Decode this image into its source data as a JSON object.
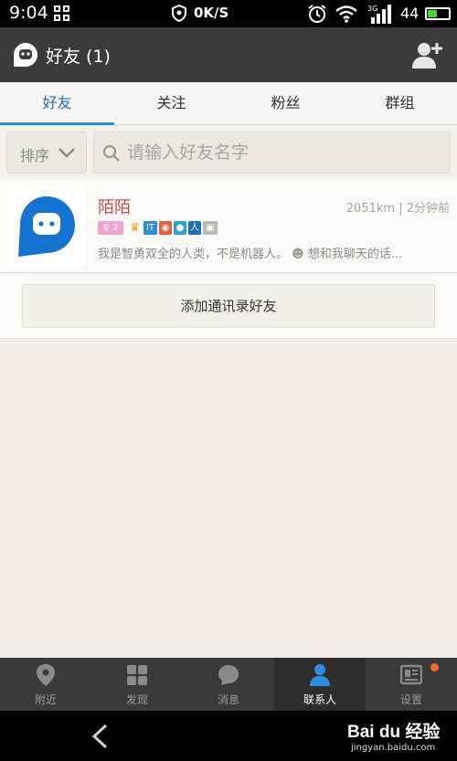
{
  "status_bar": {
    "time": "9:04",
    "network_speed": "0K/S",
    "battery_level": "44",
    "battery_fraction": 0.44
  },
  "header": {
    "title": "好友 (1)",
    "icons": {
      "logo": "momo-logo-icon",
      "action": "add-friend-icon"
    }
  },
  "tabs": [
    {
      "label": "好友",
      "active": true
    },
    {
      "label": "关注",
      "active": false
    },
    {
      "label": "粉丝",
      "active": false
    },
    {
      "label": "群组",
      "active": false
    }
  ],
  "toolbar": {
    "sort_label": "排序",
    "search_placeholder": "请输入好友名字"
  },
  "friends": [
    {
      "name": "陌陌",
      "distance": "2051km",
      "time_ago": "2分钟前",
      "level_badge": "2",
      "signature": "我是智勇双全的人类，不是机器人。",
      "status": "想和我聊天的话..."
    }
  ],
  "add_contacts_label": "添加通讯录好友",
  "bottom_nav": [
    {
      "label": "附近",
      "icon": "location-pin-icon",
      "active": false
    },
    {
      "label": "发现",
      "icon": "discover-grid-icon",
      "active": false
    },
    {
      "label": "消息",
      "icon": "message-bubble-icon",
      "active": false
    },
    {
      "label": "联系人",
      "icon": "contact-person-icon",
      "active": true
    },
    {
      "label": "设置",
      "icon": "settings-card-icon",
      "active": false,
      "has_notification": true
    }
  ],
  "watermark": {
    "logo_text": "Bai du 经验",
    "url": "jingyan.baidu.com"
  },
  "colors": {
    "accent_blue": "#2b8de0",
    "name_red": "#c9494f",
    "header_bg": "#3b3b3b",
    "notification_dot": "#f46d2a"
  }
}
